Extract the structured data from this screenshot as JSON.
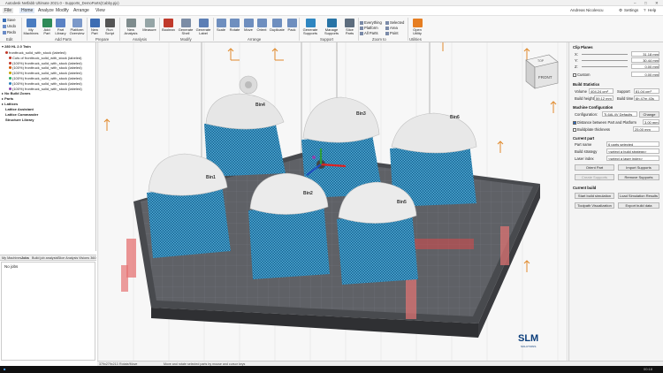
{
  "window": {
    "title": "Autodesk Netfabb Ultimate 2021.0 - Supports_DemoParts(Cabby.pjx)",
    "user": "Andreas Nicolescu",
    "settings_label": "Settings",
    "help_label": "Help"
  },
  "menu": [
    "File",
    "Home",
    "Analyze",
    "Modify",
    "Arrange",
    "View"
  ],
  "ribbon": {
    "save": "Save",
    "undo": "Undo",
    "redo": "Redo",
    "edit_group": "Edit",
    "my_machines": "My Machines",
    "add_part": "Add Part",
    "part_library": "Part Library",
    "platform_overview": "Platform Overview",
    "add_parts_group": "Add Parts",
    "new_part": "New Part",
    "run_script": "Run Script",
    "prepare_group": "Prepare",
    "new_analysis": "New Analysis",
    "measure": "Measure",
    "analysis_group": "Analysis",
    "boolean": "Boolean",
    "generate_shell": "Generate Shell",
    "generate_label": "Generate Label",
    "modify_group": "Modify",
    "scale": "Scale",
    "rotate": "Rotate",
    "move": "Move",
    "orient": "Orient",
    "duplicate": "Duplicate",
    "pack": "Pack",
    "arrange_group": "Arrange",
    "generate_supports": "Generate Supports",
    "manage_supports": "Manage Supports",
    "slice_parts": "Slice Parts",
    "support_group": "Support",
    "everything": "Everything",
    "platform": "Platform",
    "all_parts": "All Parts",
    "selected": "Selected",
    "area": "Area",
    "point": "Point",
    "zoom_group": "Zoom to",
    "open_utility": "Open Utility",
    "utilities_group": "Utilities"
  },
  "tree": {
    "root": "280 HL 2.0 Twin",
    "items": [
      {
        "label": "fronttruck_solid_with_stock (labeled)",
        "color": "#c0392b",
        "indent": 1
      },
      {
        "label": "Cuts of fronttruck_solid_with_stock (labeled)",
        "color": "#c0392b",
        "indent": 2
      },
      {
        "label": "(100%) fronttruck_solid_with_stock (labeled)",
        "color": "#c0392b",
        "indent": 2
      },
      {
        "label": "(100%) fronttruck_solid_with_stock (labeled)",
        "color": "#d35400",
        "indent": 2
      },
      {
        "label": "(100%) fronttruck_solid_with_stock (labeled)",
        "color": "#c8a000",
        "indent": 2
      },
      {
        "label": "(100%) fronttruck_solid_with_stock (labeled)",
        "color": "#27ae60",
        "indent": 2
      },
      {
        "label": "(100%) fronttruck_solid_with_stock (labeled)",
        "color": "#2980b9",
        "indent": 2
      },
      {
        "label": "(100%) fronttruck_solid_with_stock (labeled)",
        "color": "#8e44ad",
        "indent": 2
      }
    ],
    "sections": [
      "No Build Zones",
      "Parts",
      "Lattices",
      "Lattice Assistant",
      "Lattice Commander",
      "Structure Library"
    ]
  },
  "left_tabs": [
    "My Machines",
    "Jobs",
    "Build job analysis",
    "Slice Analysis",
    "Visions 360"
  ],
  "jobs_empty": "No jobs",
  "viewcube": {
    "top": "TOP",
    "front": "FRONT"
  },
  "part_labels": [
    "Bin4",
    "Bin3",
    "Bin6",
    "Bin1",
    "Bin2",
    "Bin5"
  ],
  "logo": {
    "main": "SLM",
    "sub": "SOLUTIONS"
  },
  "status": {
    "coords": "379x279x213",
    "mode": "Rotate/Move",
    "hint": "Move and rotate selected parts by mouse and cursor keys"
  },
  "right": {
    "clip_planes": "Clip Planes",
    "clip_rows": [
      {
        "axis": "X:",
        "value": "31.18 mm"
      },
      {
        "axis": "Y:",
        "value": "30.44 mm"
      },
      {
        "axis": "Z:",
        "value": "0.00 mm"
      }
    ],
    "custom": "Custom",
    "custom_value": "0.00 mm",
    "build_statistics": "Build Statistics",
    "volume_label": "Volume",
    "volume_value": "404.24 cm³",
    "support_label": "Support",
    "support_value": "81.04 cm³",
    "height_label": "Build height",
    "height_value": "59.12 mm",
    "time_label": "Build time",
    "time_value": "6h 47m 43s",
    "machine_config": "Machine Configuration",
    "config_label": "Configuration:",
    "config_value": "Ti-6Al-4V Defaults",
    "change": "Change",
    "distance_label": "Distance between Part and Platform",
    "distance_value": "3.00 mm",
    "thickness_label": "Buildplate thickness",
    "thickness_value": "25.00 mm",
    "current_part": "Current part",
    "partname_label": "Part name",
    "partname_value": "6 parts selected",
    "strategy_label": "Build strategy",
    "strategy_value": "<select a build strategy>",
    "laser_label": "Laser index",
    "laser_value": "<select a laser index>",
    "orient_part": "Orient Part",
    "import_supports": "Import Supports",
    "create_supports": "Create Supports",
    "remove_supports": "Remove Supports",
    "current_build": "Current build",
    "start_sim": "Start build simulation",
    "load_sim": "Load Simulation Results",
    "toolpath": "Toolpath Visualization",
    "export_build": "Export build data"
  },
  "taskbar": {
    "time": "00:18"
  }
}
